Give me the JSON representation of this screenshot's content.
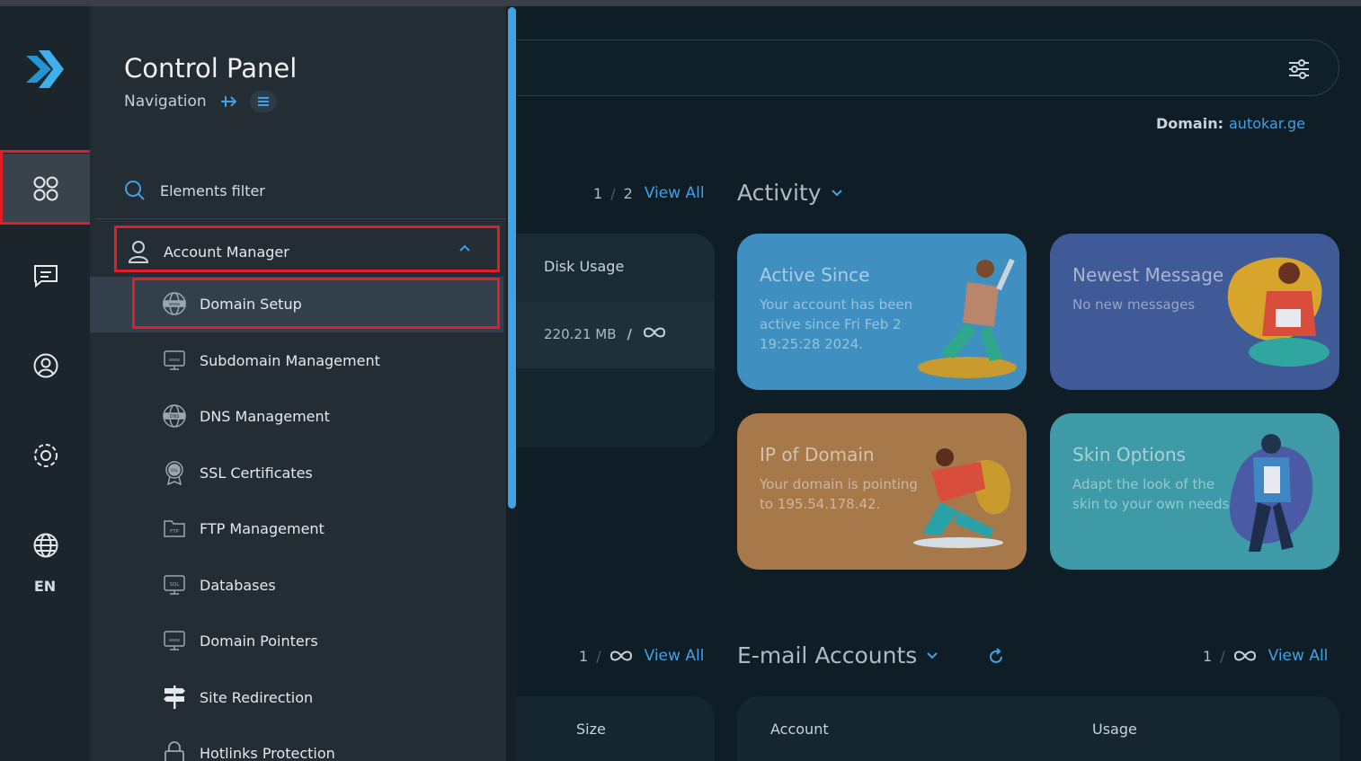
{
  "sidebar_panel": {
    "title": "Control Panel",
    "subtitle": "Navigation",
    "filter_label": "Elements filter",
    "group_label": "Account Manager",
    "items": [
      {
        "label": "Domain Setup",
        "icon": "www-globe-icon"
      },
      {
        "label": "Subdomain Management",
        "icon": "www-monitor-icon"
      },
      {
        "label": "DNS Management",
        "icon": "dns-globe-icon"
      },
      {
        "label": "SSL Certificates",
        "icon": "ssl-badge-icon"
      },
      {
        "label": "FTP Management",
        "icon": "ftp-folder-icon"
      },
      {
        "label": "Databases",
        "icon": "sql-database-icon"
      },
      {
        "label": "Domain Pointers",
        "icon": "www-monitor-icon"
      },
      {
        "label": "Site Redirection",
        "icon": "signpost-icon"
      },
      {
        "label": "Hotlinks Protection",
        "icon": "lock-icon"
      }
    ]
  },
  "rail": {
    "language": "EN"
  },
  "header": {
    "domain_label": "Domain:",
    "domain_value": "autokar.ge"
  },
  "disk": {
    "pager_current": "1",
    "pager_sep": "/",
    "pager_total": "2",
    "view_all": "View All",
    "header": "Disk Usage",
    "used": "220.21 MB",
    "slash": "/"
  },
  "activity": {
    "title": "Activity",
    "cards": [
      {
        "title": "Active Since",
        "desc": "Your account has been active since Fri Feb 2 19:25:28 2024.",
        "color": "#3f8fc0"
      },
      {
        "title": "Newest Message",
        "desc": "No new messages",
        "color": "#3f5a97"
      },
      {
        "title": "IP of Domain",
        "desc": "Your domain is pointing to 195.54.178.42.",
        "color": "#a7784a"
      },
      {
        "title": "Skin Options",
        "desc": "Adapt the look of the skin to your own needs.",
        "color": "#3e9aa6"
      }
    ]
  },
  "lower_left": {
    "pager_current": "1",
    "pager_sep": "/",
    "view_all": "View All",
    "col_size": "Size"
  },
  "email": {
    "title": "E-mail Accounts",
    "pager_current": "1",
    "pager_sep": "/",
    "view_all": "View All",
    "col_account": "Account",
    "col_usage": "Usage"
  },
  "colors": {
    "accent": "#3fa2e6",
    "highlight": "#e11d2a"
  }
}
